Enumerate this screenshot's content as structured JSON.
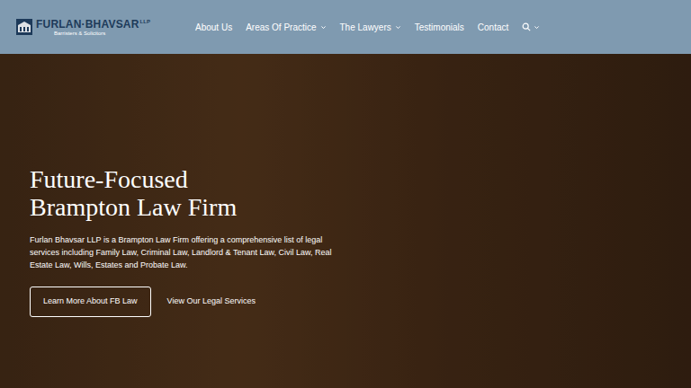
{
  "header": {
    "logo": {
      "name": "FURLAN·BHAVSAR",
      "suffix": "LLP",
      "tagline": "Barristers & Solicitors"
    },
    "nav": [
      {
        "label": "About Us",
        "dropdown": false
      },
      {
        "label": "Areas Of Practice",
        "dropdown": true
      },
      {
        "label": "The Lawyers",
        "dropdown": true
      },
      {
        "label": "Testimonials",
        "dropdown": false
      },
      {
        "label": "Contact",
        "dropdown": false
      }
    ],
    "search": {
      "dropdown": true
    }
  },
  "hero": {
    "title_lines": [
      "Future-Focused",
      "Brampton Law Firm"
    ],
    "description": "Furlan Bhavsar LLP is a Brampton Law Firm offering a comprehensive list of legal services including Family Law, Criminal Law, Landlord & Tenant Law, Civil Law, Real Estate Law, Wills, Estates and Probate Law.",
    "buttons": [
      {
        "label": "Learn More About FB Law",
        "kind": "outline"
      },
      {
        "label": "View Our Legal Services",
        "kind": "text"
      }
    ]
  }
}
